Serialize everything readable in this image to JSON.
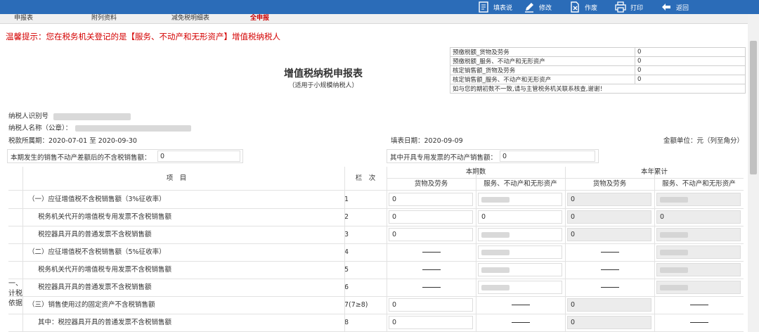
{
  "toolbar": {
    "items": [
      {
        "label": "填表说",
        "icon": "document-icon"
      },
      {
        "label": "修改",
        "icon": "pencil-icon"
      },
      {
        "label": "作废",
        "icon": "void-document-icon"
      },
      {
        "label": "打印",
        "icon": "printer-icon"
      },
      {
        "label": "返回",
        "icon": "back-arrow-icon"
      }
    ]
  },
  "tabs": [
    "申报表",
    "附列资料",
    "减免税明细表",
    "全申报"
  ],
  "tip": "温馨提示：您在税务机关登记的是【服务、不动产和无形资产】增值税纳税人",
  "form": {
    "title": "增值税纳税申报表",
    "subtitle": "（适用于小规模纳税人）"
  },
  "side_table": {
    "rows": [
      {
        "key": "预缴税额_货物及劳务",
        "value": "0"
      },
      {
        "key": "预缴税额_服务、不动产和无形资产",
        "value": "0"
      },
      {
        "key": "核定销售额_货物及劳务",
        "value": "0"
      },
      {
        "key": "核定销售额_服务、不动产和无形资产",
        "value": "0"
      }
    ],
    "note": "如与您的期初数不一致,请与主管税务机关联系核查,谢谢！"
  },
  "taxpayer": {
    "id_label": "纳税人识别号",
    "name_label": "纳税人名称（公章）：",
    "period_label": "税款所属期：",
    "period_value": "2020-07-01 至 2020-09-30",
    "fill_date_label": "填表日期：",
    "fill_date_value": "2020-09-09",
    "unit": "金额单位：元（列至角分）"
  },
  "fields": {
    "deduct_label": "本期发生的销售不动产差额后的不含税销售额：",
    "deduct_value": "0",
    "special_label": "其中开具专用发票的不动产销售额：",
    "special_value": "0"
  },
  "table": {
    "col_item": "项　目",
    "col_line": "栏　次",
    "col_current": "本期数",
    "col_ytd": "本年累计",
    "sub_goods": "货物及劳务",
    "sub_service": "服务、不动产和无形资产",
    "side_label": "一、计税依据",
    "rows": [
      {
        "item": "（一）应征增值税不含税销售额（3%征收率）",
        "line": "1",
        "c1": "0",
        "c2": "",
        "c3": "0",
        "c4": "",
        "indent": 0
      },
      {
        "item": "税务机关代开的增值税专用发票不含税销售额",
        "line": "2",
        "c1": "0",
        "c2": "0",
        "c3": "0",
        "c4": "0",
        "indent": 1
      },
      {
        "item": "税控器具开具的普通发票不含税销售额",
        "line": "3",
        "c1": "0",
        "c2": "",
        "c3": "0",
        "c4": "",
        "indent": 1
      },
      {
        "item": "（二）应征增值税不含税销售额（5%征收率）",
        "line": "4",
        "c1": "——",
        "c2": "",
        "c3": "——",
        "c4": "",
        "indent": 0
      },
      {
        "item": "税务机关代开的增值税专用发票不含税销售额",
        "line": "5",
        "c1": "——",
        "c2": "",
        "c3": "——",
        "c4": "",
        "indent": 1
      },
      {
        "item": "税控器具开具的普通发票不含税销售额",
        "line": "6",
        "c1": "——",
        "c2": "",
        "c3": "——",
        "c4": "",
        "indent": 1
      },
      {
        "item": "（三）销售使用过的固定资产不含税销售额",
        "line": "7(7≥8)",
        "c1": "0",
        "c2": "——",
        "c3": "0",
        "c4": "——",
        "indent": 0
      },
      {
        "item": "其中：税控器具开具的普通发票不含税销售额",
        "line": "8",
        "c1": "0",
        "c2": "——",
        "c3": "0",
        "c4": "——",
        "indent": 1
      }
    ]
  }
}
